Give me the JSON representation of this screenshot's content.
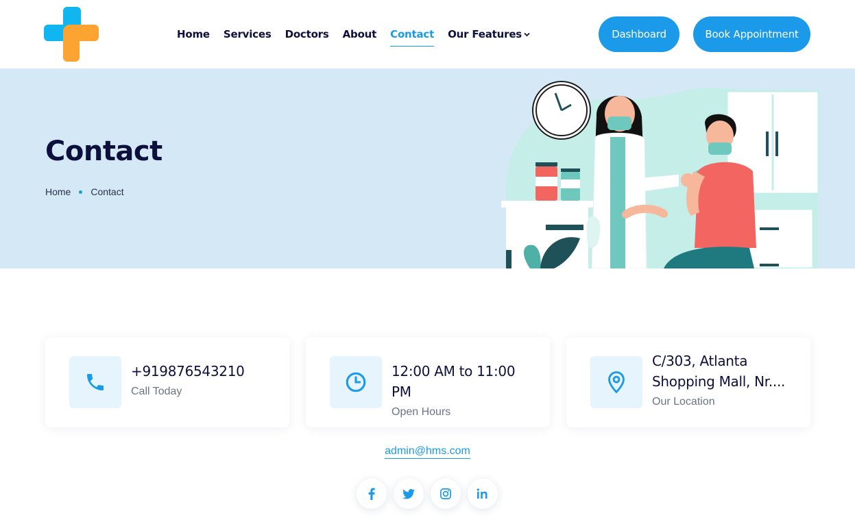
{
  "colors": {
    "accent": "#1a9ae8",
    "hero_bg": "#d4e9f5",
    "heading": "#0d0f3d",
    "logo_blue": "#11b5f0",
    "logo_orange": "#fba431"
  },
  "header": {
    "logo_icon": "medical-cross-logo",
    "nav": [
      {
        "label": "Home"
      },
      {
        "label": "Services"
      },
      {
        "label": "Doctors"
      },
      {
        "label": "About"
      },
      {
        "label": "Contact",
        "active": true
      },
      {
        "label": "Our Features",
        "has_dropdown": true
      }
    ],
    "dashboard_label": "Dashboard",
    "book_label": "Book Appointment"
  },
  "hero": {
    "title": "Contact",
    "breadcrumb": [
      "Home",
      "Contact"
    ],
    "illustration": "doctor-vaccinating-patient"
  },
  "contact_cards": [
    {
      "icon": "phone-icon",
      "value": "+919876543210",
      "label": "Call Today"
    },
    {
      "icon": "clock-icon",
      "value": "12:00 AM to 11:00 PM",
      "label": "Open Hours"
    },
    {
      "icon": "location-pin-icon",
      "value": "C/303, Atlanta Shopping Mall, Nr....",
      "label": "Our Location"
    }
  ],
  "email": "admin@hms.com",
  "socials": [
    {
      "icon": "facebook-icon",
      "glyph": "f"
    },
    {
      "icon": "twitter-icon",
      "glyph": ""
    },
    {
      "icon": "instagram-icon",
      "glyph": ""
    },
    {
      "icon": "linkedin-icon",
      "glyph": "in"
    }
  ]
}
